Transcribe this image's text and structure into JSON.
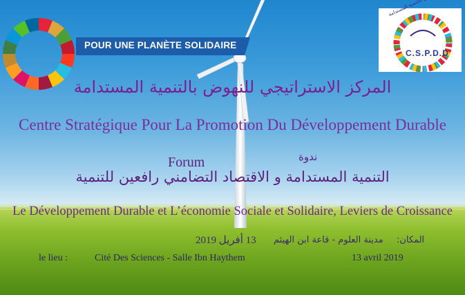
{
  "colors": {
    "title_purple": "#7a1f8f",
    "subtitle_purple": "#5b1f7e",
    "info_navy": "#2d2560",
    "banner_blue": "#1d5ca8",
    "sky_blue": "#3b9bd9",
    "grass_green": "#6ea51f"
  },
  "sdg_logo": {
    "icon": "sdg-wheel-icon",
    "banner_text": "POUR UNE PLANÈTE SOLIDAIRE"
  },
  "org_logo": {
    "icon": "cspdd-emblem-icon",
    "arabic_name": "المركز الإستراتيجي للنهوض بالتنمية المستدامة",
    "abbreviation": "C.S.P.D.D"
  },
  "header": {
    "arabic_title": "المركز الاستراتيجي للنهوض بالتنمية المستدامة",
    "french_title": "Centre Stratégique Pour La Promotion Du Développement  Durable"
  },
  "event": {
    "type_fr": "Forum",
    "type_ar": "ندوة",
    "theme_ar": "التنمية المستدامة و الاقتصاد التضامني رافعين للتنمية",
    "theme_fr": "Le Développement Durable et L’économie Sociale et Solidaire, Leviers de Croissance"
  },
  "details": {
    "place_label_ar": "المكان:",
    "place_ar": "مدينة العلوم - قاعة ابن الهيثم",
    "date_ar": "13 أفريل 2019",
    "place_label_fr": "le lieu :",
    "place_fr": "Cité Des Sciences - Salle Ibn Haythem",
    "date_fr": "13 avril 2019"
  },
  "background": {
    "icon": "wind-turbine-icon"
  }
}
